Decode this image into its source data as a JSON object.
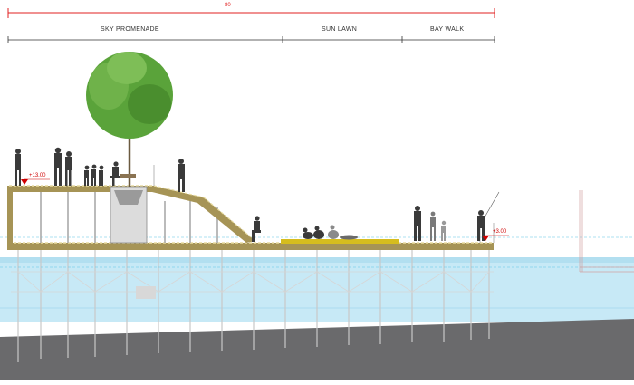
{
  "overall_dimension": "80",
  "zones": [
    {
      "label": "SKY PROMENADE"
    },
    {
      "label": "SUN LAWN"
    },
    {
      "label": "BAY WALK"
    }
  ],
  "elevations": {
    "upper": "+13.00",
    "lower": "+3.00"
  },
  "colors": {
    "dimension_red": "#e02020",
    "deck_olive": "#a89858",
    "water": "#bfe6f4",
    "ground": "#6b6b6d",
    "lawn": "#d8c020",
    "tree": "#5aa33a"
  }
}
